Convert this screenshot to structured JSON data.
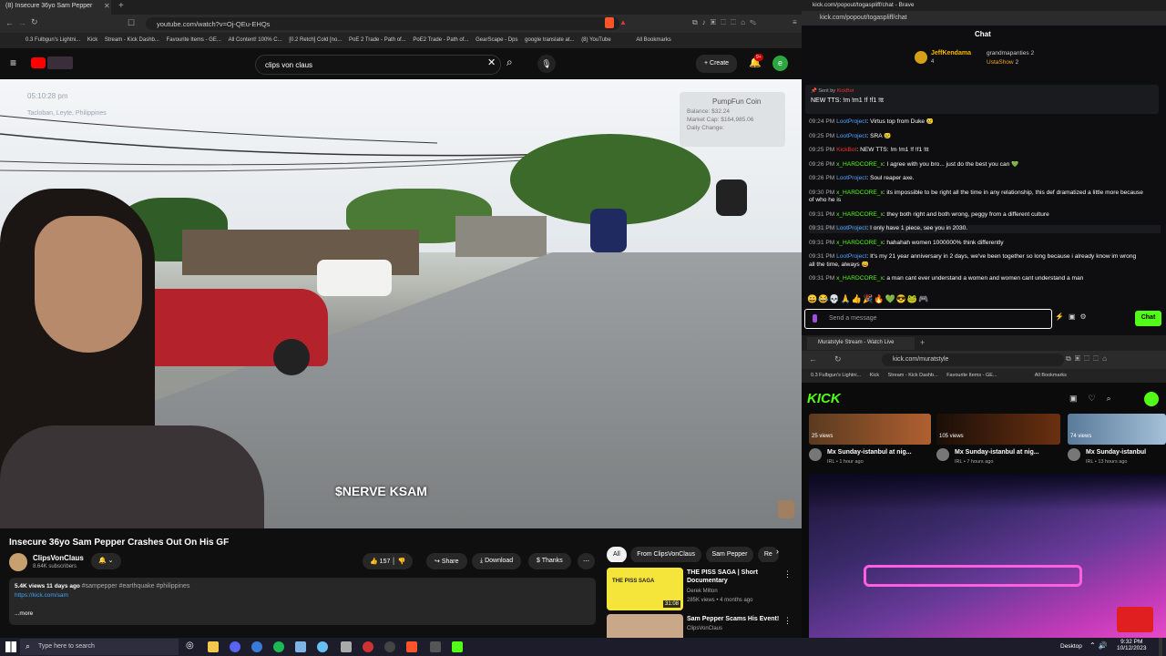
{
  "yt_window": {
    "tab_title": "(8) Insecure 36yo Sam Pepper",
    "url": "youtube.com/watch?v=Oj-QEu-EHQs",
    "bookmarks": [
      "0.3 Fulbgun's Lightni...",
      "Kick",
      "Stream - Kick Dashb...",
      "Favourite Items - GE...",
      "All Content! 100% C...",
      "[0.2 Retch] Cold [no...",
      "PoE 2 Trade - Path of...",
      "PoE2 Trade - Path of...",
      "GearScape - Dps",
      "google translate at...",
      "(8) YouTube",
      "All Bookmarks"
    ]
  },
  "yt": {
    "search_value": "clips von claus",
    "create_label": "Create",
    "notif_count": "9+",
    "avatar_letter": "e",
    "overlay_time": "05:10:28 pm",
    "overlay_location": "Tacloban, Leyte, Philippines",
    "coin_title": "PumpFun Coin",
    "coin_balance": "Balance: $32.24",
    "coin_mcap": "Market Cap: $164,985.06",
    "coin_change": "Daily Change:",
    "watermark": "$NERVE KSAM",
    "video_title": "Insecure 36yo Sam Pepper Crashes Out On His GF",
    "channel": "ClipsVonClaus",
    "subs": "8.64K subscribers",
    "likes": "157",
    "share": "Share",
    "download": "Download",
    "thanks": "Thanks",
    "desc_stats": "5.4K views  11 days ago",
    "desc_tags": "#sampepper #earthquake #philippines",
    "desc_link": "https://kick.com/sam",
    "more": "...more",
    "chips": [
      "All",
      "From ClipsVonClaus",
      "Sam Pepper",
      "Re"
    ],
    "rec": [
      {
        "title": "THE PISS SAGA | Short Documentary",
        "channel": "Derek Milton",
        "meta": "285K views • 4 months ago",
        "duration": "31:08",
        "thumb_text": "THE PISS SAGA"
      },
      {
        "title": "Sam Pepper Scams His Event!",
        "channel": "ClipsVonClaus",
        "meta": "",
        "duration": "",
        "thumb_text": ""
      }
    ]
  },
  "kick_chat": {
    "url": "kick.com/popout/togaspliff/chat",
    "heading": "Chat",
    "top_gifter": "JeffKendama",
    "top_gifter_count": "4",
    "gifters": [
      {
        "name": "grandmapanties",
        "count": "2"
      },
      {
        "name": "UstaShow",
        "count": "2"
      }
    ],
    "pinned_by": "Sent by",
    "pinned_user": "KickBot",
    "pinned_text": "NEW TTS: !m !m1 !f !f1 !tt",
    "messages": [
      {
        "time": "09:24 PM",
        "user": "LootProject",
        "text": ": Virtus top from Duke 😢"
      },
      {
        "time": "09:25 PM",
        "user": "LootProject",
        "text": ": SRA 😢"
      },
      {
        "time": "09:25 PM",
        "user": "KickBot",
        "text": ": NEW TTS: !m !m1 !f !f1 !tt"
      },
      {
        "time": "09:26 PM",
        "user": "x_HARDCORE_x",
        "text": ": I agree with you bro... just do the best you can 💚"
      },
      {
        "time": "09:26 PM",
        "user": "LootProject",
        "text": ": Soul reaper axe."
      },
      {
        "time": "09:30 PM",
        "user": "x_HARDCORE_x",
        "text": ": its impossible to be right all the time in any relationship, this def dramatized a little more because"
      },
      {
        "time": "",
        "user": "",
        "text": "of who he is"
      },
      {
        "time": "09:31 PM",
        "user": "x_HARDCORE_x",
        "text": ": they both right and both wrong, peggy from a different culture"
      },
      {
        "time": "09:31 PM",
        "user": "LootProject",
        "text": ": I only have 1 piece, see you in 2030."
      },
      {
        "time": "09:31 PM",
        "user": "x_HARDCORE_x",
        "text": ": hahahah women 1000000% think differently"
      },
      {
        "time": "09:31 PM",
        "user": "LootProject",
        "text": ": It's my 21 year anniversary in 2 days, we've been together so long because i already know im wrong"
      },
      {
        "time": "",
        "user": "",
        "text": "all the time, always 😄"
      },
      {
        "time": "09:31 PM",
        "user": "x_HARDCORE_x",
        "text": ": a man cant ever understand a women and women cant understand a man"
      }
    ],
    "input_placeholder": "Send a message",
    "send_label": "Chat"
  },
  "kick_stream": {
    "tab_title": "Muratstyle Stream - Watch Live",
    "url": "kick.com/muratstyle",
    "bookmarks": [
      "0.3 Fulbgun's Lightni...",
      "Kick",
      "Stream - Kick Dashb...",
      "Favourite Items - GE...",
      "All Bookmarks"
    ],
    "logo": "KICK",
    "cards": [
      {
        "views": "25 views",
        "title": "Mx Sunday-istanbul at nig...",
        "meta": "IRL • 1 hour ago"
      },
      {
        "views": "105 views",
        "title": "Mx Sunday-istanbul at nig...",
        "meta": "IRL • 7 hours ago"
      },
      {
        "views": "74 views",
        "title": "Mx Sunday-istanbul",
        "meta": "IRL • 13 hours ago"
      }
    ]
  },
  "taskbar": {
    "search_placeholder": "Type here to search",
    "desktop_label": "Desktop",
    "time": "9:32 PM",
    "date": "10/12/2023"
  }
}
